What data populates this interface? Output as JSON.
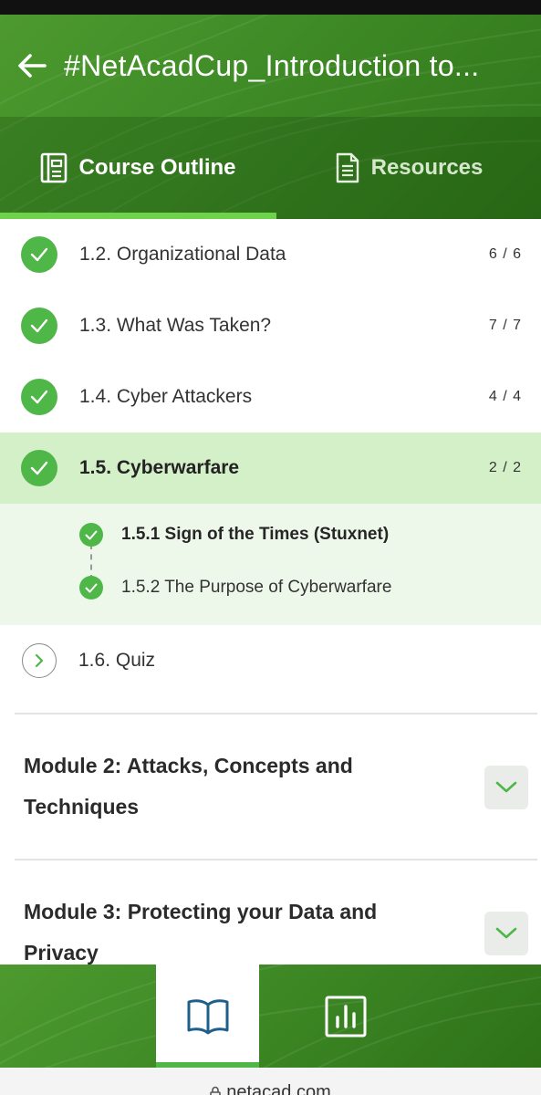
{
  "header": {
    "title": "#NetAcadCup_Introduction to..."
  },
  "tabs": [
    {
      "label": "Course Outline",
      "icon": "outline-icon",
      "active": true
    },
    {
      "label": "Resources",
      "icon": "document-icon",
      "active": false
    }
  ],
  "topics": [
    {
      "label": "1.2. Organizational Data",
      "count": "6 / 6",
      "status": "complete"
    },
    {
      "label": "1.3. What Was Taken?",
      "count": "7 / 7",
      "status": "complete"
    },
    {
      "label": "1.4. Cyber Attackers",
      "count": "4 / 4",
      "status": "complete"
    },
    {
      "label": "1.5. Cyberwarfare",
      "count": "2 / 2",
      "status": "complete",
      "active": true
    }
  ],
  "subtopics": [
    {
      "label": "1.5.1 Sign of the Times (Stuxnet)",
      "status": "complete",
      "current": true
    },
    {
      "label": "1.5.2 The Purpose of Cyberwarfare",
      "status": "complete"
    }
  ],
  "quiz": {
    "label": "1.6. Quiz",
    "icon": "chevron-right-icon"
  },
  "modules": [
    {
      "title": "Module 2: Attacks, Concepts and Techniques",
      "icon": "chevron-down-icon"
    },
    {
      "title": "Module 3: Protecting your Data and Privacy",
      "icon": "chevron-down-icon"
    }
  ],
  "bottom_nav": [
    {
      "icon": "book-icon",
      "active": true
    },
    {
      "icon": "bar-chart-icon",
      "active": false
    }
  ],
  "browser": {
    "url": "netacad.com"
  },
  "colors": {
    "brand_green": "#3e8a26",
    "check_green": "#4fb648",
    "active_row": "#d4f0c8",
    "sub_panel": "#eef8ea"
  }
}
